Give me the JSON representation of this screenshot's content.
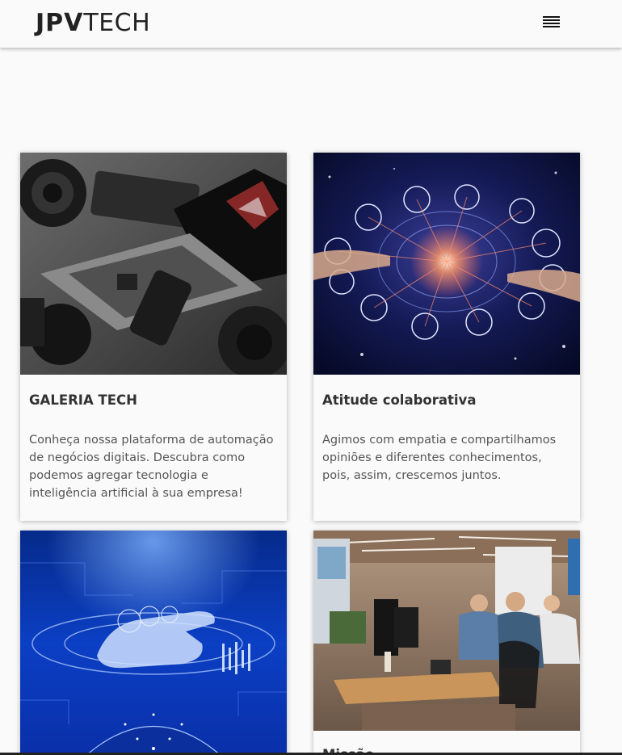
{
  "header": {
    "logo_bold": "JPV",
    "logo_light": "TECH",
    "menu_icon": "hamburger-menu-icon"
  },
  "cards": [
    {
      "title": "GALERIA TECH",
      "text": "Conheça nossa plataforma de automação de negócios digitais. Descubra como podemos agregar tecnologia e inteligência artificial à sua empresa!",
      "image": "laptop-and-camera-photo"
    },
    {
      "title": "Atitude colaborativa",
      "text": "Agimos com empatia e compartilhamos opiniões e diferentes conhecimentos, pois, assim, crescemos juntos.",
      "image": "digital-network-globe-photo"
    },
    {
      "title": "",
      "text": "",
      "image": "blue-digital-hand-photo"
    },
    {
      "title": "Missão",
      "text": "",
      "image": "office-team-photo"
    }
  ],
  "colors": {
    "background": "#fafafa",
    "text": "#333333",
    "muted_text": "#555555"
  }
}
